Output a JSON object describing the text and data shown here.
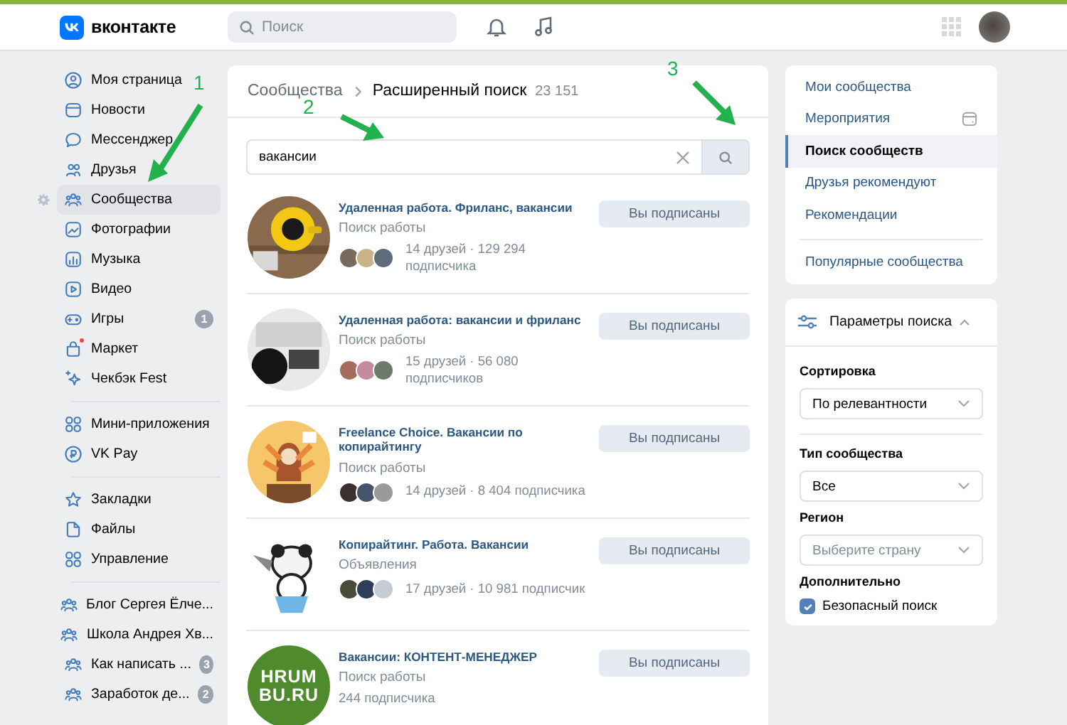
{
  "header": {
    "logo_text": "вконтакте",
    "search": {
      "placeholder": "Поиск"
    }
  },
  "nav": {
    "groups": [
      [
        {
          "label": "Моя страница",
          "selected": false
        },
        {
          "label": "Новости",
          "selected": false
        },
        {
          "label": "Мессенджер",
          "selected": false
        },
        {
          "label": "Друзья",
          "selected": false
        },
        {
          "label": "Сообщества",
          "selected": true
        },
        {
          "label": "Фотографии",
          "selected": false
        },
        {
          "label": "Музыка",
          "selected": false
        },
        {
          "label": "Видео",
          "selected": false
        },
        {
          "label": "Игры",
          "selected": false,
          "badge": "1"
        },
        {
          "label": "Маркет",
          "selected": false,
          "dot": true
        },
        {
          "label": "Чекбэк Fest",
          "selected": false
        }
      ],
      [
        {
          "label": "Мини-приложения",
          "selected": false
        },
        {
          "label": "VK Pay",
          "selected": false
        }
      ],
      [
        {
          "label": "Закладки",
          "selected": false
        },
        {
          "label": "Файлы",
          "selected": false
        },
        {
          "label": "Управление",
          "selected": false
        }
      ],
      [
        {
          "label": "Блог Сергея Ёлче...",
          "selected": false
        },
        {
          "label": "Школа Андрея Хв...",
          "selected": false
        },
        {
          "label": "Как написать ...",
          "selected": false,
          "badge": "3"
        },
        {
          "label": "Заработок де...",
          "selected": false,
          "badge": "2"
        }
      ]
    ]
  },
  "main": {
    "breadcrumb": {
      "parent": "Сообщества",
      "current": "Расширенный поиск",
      "count": "23 151"
    },
    "search": {
      "value": "вакансии"
    },
    "results": [
      {
        "title": "Удаленная работа. Фриланс, вакансии",
        "category": "Поиск работы",
        "has_friends": true,
        "stats": "14 друзей · 129 294 подписчика",
        "button": "Вы подписаны"
      },
      {
        "title": "Удаленная работа: вакансии и фриланс",
        "category": "Поиск работы",
        "has_friends": true,
        "stats": "15 друзей · 56 080 подписчиков",
        "button": "Вы подписаны"
      },
      {
        "title": "Freelance Choice. Вакансии по копирайтингу",
        "category": "Поиск работы",
        "has_friends": true,
        "stats": "14 друзей · 8 404 подписчика",
        "button": "Вы подписаны"
      },
      {
        "title": "Копирайтинг. Работа. Вакансии",
        "category": "Объявления",
        "has_friends": true,
        "stats": "17 друзей · 10 981 подписчик",
        "button": "Вы подписаны"
      },
      {
        "avatar": {
          "kind": "logo",
          "lines": [
            "HRUM",
            "BU.RU"
          ]
        },
        "title": "Вакансии: КОНТЕНТ-МЕНЕДЖЕР",
        "category": "Поиск работы",
        "has_friends": false,
        "stats": "244 подписчика",
        "button": "Вы подписаны"
      }
    ]
  },
  "side_menu": {
    "items": [
      {
        "label": "Мои сообщества",
        "selected": false
      },
      {
        "label": "Мероприятия",
        "selected": false
      },
      {
        "label": "Поиск сообществ",
        "selected": true
      },
      {
        "label": "Друзья рекомендуют",
        "selected": false
      },
      {
        "label": "Рекомендации",
        "selected": false
      },
      {
        "label": "Популярные сообщества",
        "selected": false
      }
    ]
  },
  "filters": {
    "title": "Параметры поиска",
    "expanded": true,
    "sections": [
      {
        "kind": "select",
        "label": "Сортировка",
        "value": "По релевантности"
      },
      {
        "kind": "select",
        "label": "Тип сообщества",
        "value": "Все"
      },
      {
        "kind": "select",
        "label": "Регион",
        "placeholder": "Выберите страну"
      },
      {
        "kind": "checkbox",
        "label": "Дополнительно",
        "option": "Безопасный поиск",
        "checked": true
      }
    ]
  },
  "annotations": [
    {
      "label": "1"
    },
    {
      "label": "2"
    },
    {
      "label": "3"
    }
  ]
}
